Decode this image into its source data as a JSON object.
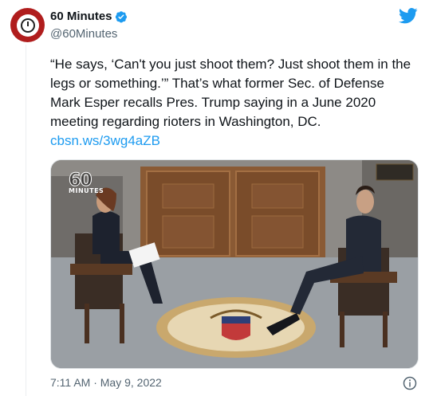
{
  "author": {
    "display_name": "60 Minutes",
    "handle": "@60Minutes",
    "verified": true,
    "avatar_icon": "60-minutes-stopwatch-logo"
  },
  "tweet": {
    "text": "“He says, ‘Can't you just shoot them? Just shoot them in the legs or something.’” That’s what former Sec. of Defense Mark Esper recalls Pres. Trump saying in a June 2020 meeting regarding rioters in Washington, DC. ",
    "link": "cbsn.ws/3wg4aZB",
    "timestamp": "7:11 AM · May 9, 2022"
  },
  "media": {
    "logo_number": "60",
    "logo_word": "MINUTES"
  },
  "icons": {
    "brand": "twitter-bird-icon",
    "info": "info-icon"
  },
  "colors": {
    "link": "#1d9bf0",
    "verified": "#1d9bf0",
    "twitter_brand": "#1d9bf0",
    "secondary_text": "#536471"
  }
}
